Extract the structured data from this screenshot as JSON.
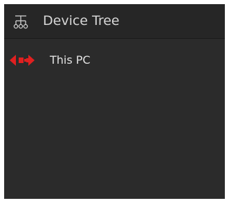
{
  "header": {
    "title": "Device Tree",
    "icon": "hierarchy-icon"
  },
  "tree": {
    "nodes": [
      {
        "label": "This PC",
        "icon": "device-arrows-icon",
        "icon_color": "#e02020"
      }
    ]
  },
  "colors": {
    "panel_bg": "#2b2b2b",
    "header_bg": "#262626",
    "text": "#d6d6d6",
    "accent": "#e02020"
  }
}
